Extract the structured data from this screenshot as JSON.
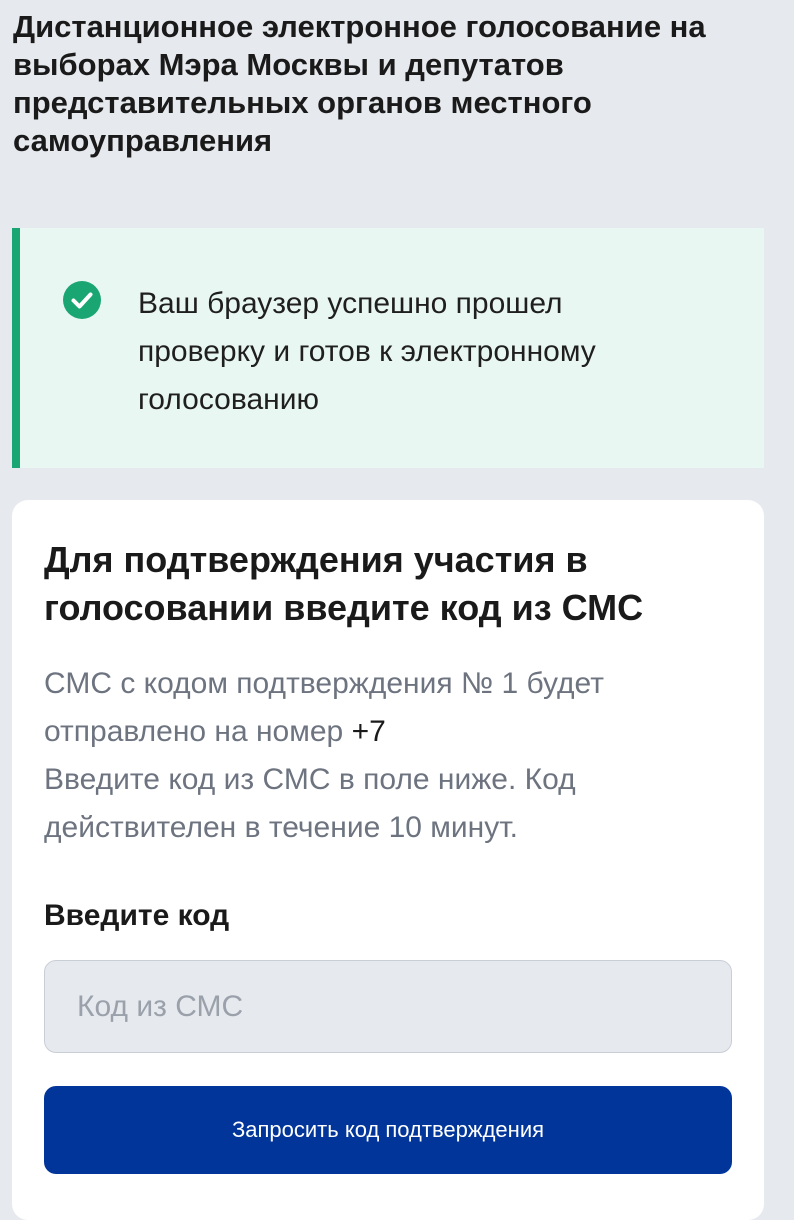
{
  "page": {
    "title": "Дистанционное электронное голосование на выборах Мэра Москвы и депутатов представительных органов местного самоуправления"
  },
  "success_banner": {
    "icon": "check-circle-icon",
    "text": "Ваш браузер успешно прошел\nпроверку и готов к электронному\nголосованию",
    "accent_color": "#1aa673",
    "background_color": "#e9f7f2"
  },
  "confirm_card": {
    "title": "Для подтверждения участия в голосовании введите код из СМС",
    "description": {
      "line1": "СМС с кодом подтверждения № 1 будет",
      "line2_prefix": "отправлено на номер ",
      "phone": "+7",
      "line3": "Введите код из СМС в поле ниже. Код",
      "line4": "действителен в течение 10 минут."
    },
    "field_label": "Введите код",
    "code_input": {
      "placeholder": "Код из СМС",
      "value": ""
    },
    "request_button_label": "Запросить код подтверждения",
    "button_color": "#02359a"
  }
}
